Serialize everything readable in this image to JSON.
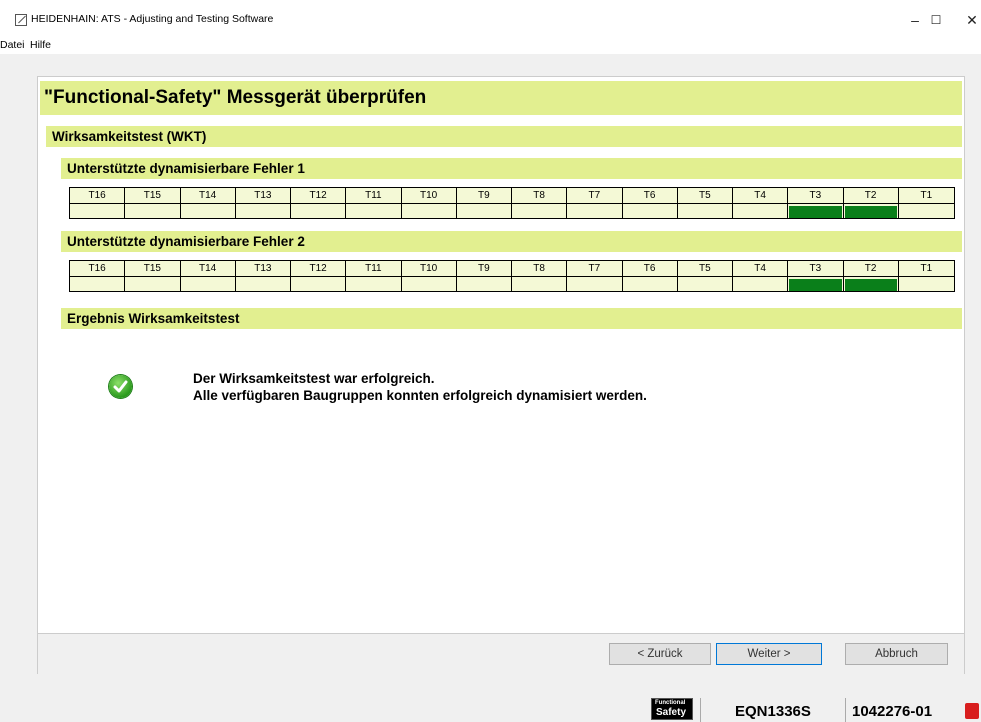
{
  "window": {
    "title": "HEIDENHAIN: ATS - Adjusting and Testing Software",
    "minimize": "–",
    "maximize": "☐",
    "close": "✕"
  },
  "menu": [
    "Datei",
    "Hilfe"
  ],
  "page": {
    "header": "\"Functional-Safety\" Messgerät überprüfen",
    "section_wkt": "Wirksamkeitstest (WKT)",
    "section_errors1": "Unterstützte dynamisierbare Fehler 1",
    "section_errors2": "Unterstützte dynamisierbare Fehler 2",
    "section_result": "Ergebnis Wirksamkeitstest",
    "test_columns": [
      "T16",
      "T15",
      "T14",
      "T13",
      "T12",
      "T11",
      "T10",
      "T9",
      "T8",
      "T7",
      "T6",
      "T5",
      "T4",
      "T3",
      "T2",
      "T1"
    ],
    "errors1_active": [
      false,
      false,
      false,
      false,
      false,
      false,
      false,
      false,
      false,
      false,
      false,
      false,
      false,
      true,
      true,
      false
    ],
    "errors2_active": [
      false,
      false,
      false,
      false,
      false,
      false,
      false,
      false,
      false,
      false,
      false,
      false,
      false,
      true,
      true,
      false
    ],
    "result_line1": "Der Wirksamkeitstest war erfolgreich.",
    "result_line2": "Alle verfügbaren Baugruppen konnten erfolgreich dynamisiert werden.",
    "result_icon": "success-check-icon",
    "active_color": "#0a7f1a",
    "header_color": "#e2ef90"
  },
  "buttons": {
    "back": "< Zurück",
    "next": "Weiter >",
    "cancel": "Abbruch"
  },
  "status": {
    "logo_line1": "Functional",
    "logo_line2": "Safety",
    "device": "EQN1336S",
    "id": "1042276-01"
  }
}
